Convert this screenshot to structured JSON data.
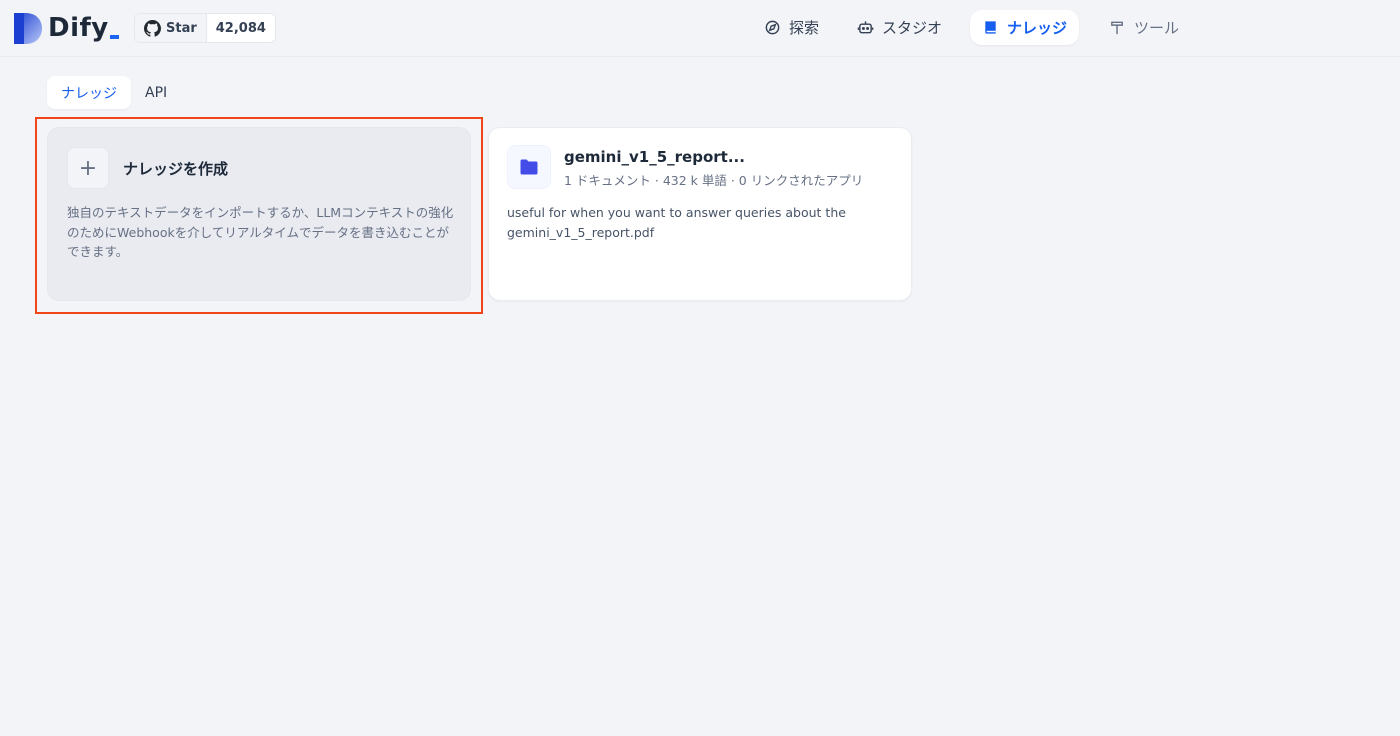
{
  "app": {
    "logo_text": "Dify",
    "github": {
      "star_label": "Star",
      "star_count": "42,084"
    }
  },
  "nav": {
    "items": [
      {
        "label": "探索",
        "icon": "compass-icon",
        "active": false
      },
      {
        "label": "スタジオ",
        "icon": "robot-icon",
        "active": false
      },
      {
        "label": "ナレッジ",
        "icon": "book-icon",
        "active": true
      },
      {
        "label": "ツール",
        "icon": "hammer-icon",
        "active": false
      }
    ]
  },
  "tabs": [
    {
      "label": "ナレッジ",
      "active": true
    },
    {
      "label": "API",
      "active": false
    }
  ],
  "create_card": {
    "title": "ナレッジを作成",
    "plus": "+",
    "description": "独自のテキストデータをインポートするか、LLMコンテキストの強化のためにWebhookを介してリアルタイムでデータを書き込むことができます。"
  },
  "datasets": [
    {
      "name": "gemini_v1_5_report...",
      "meta": "1 ドキュメント · 432 k 単語 · 0 リンクされたアプリ",
      "description": "useful for when you want to answer queries about the gemini_v1_5_report.pdf"
    }
  ],
  "colors": {
    "accent": "#155eef",
    "highlight_border": "#f04419",
    "folder_icon": "#444ce7",
    "background": "#f2f4f7"
  }
}
